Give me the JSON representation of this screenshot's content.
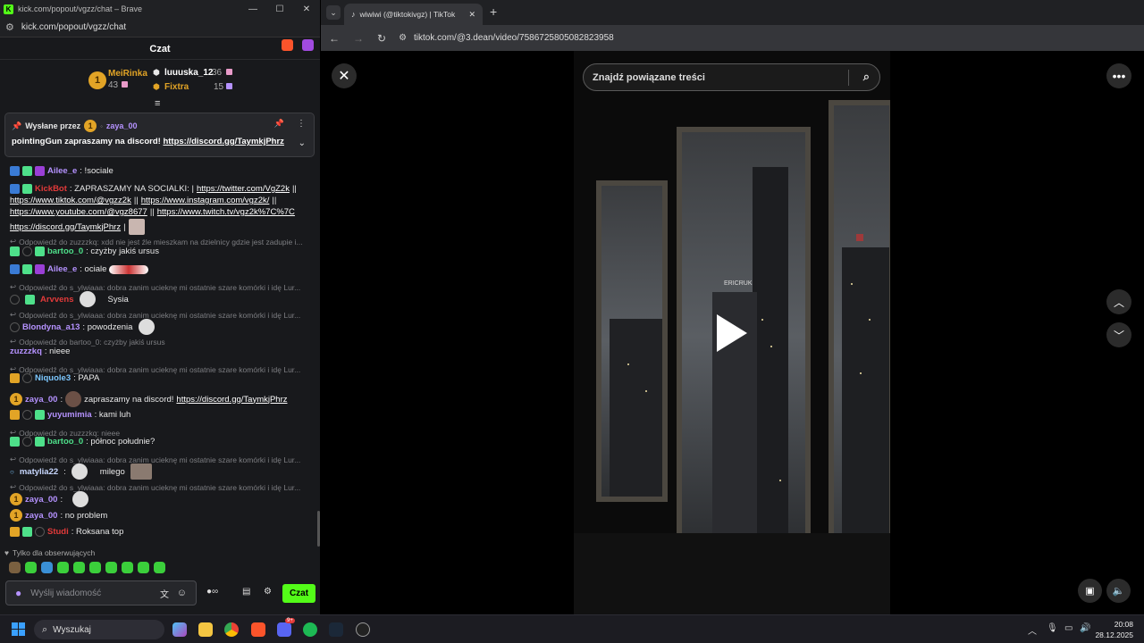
{
  "left_window": {
    "title": "kick.com/popout/vgzz/chat – Brave",
    "url": "kick.com/popout/vgzz/chat"
  },
  "chat": {
    "header": "Czat",
    "leaderboard": [
      {
        "rank": "1",
        "name": "MeiRinka",
        "count": "43"
      },
      {
        "name": "luuuska_12",
        "count": "36"
      },
      {
        "name": "Fixtra",
        "count": "15"
      }
    ],
    "pinned": {
      "sent_by_label": "Wysłane przez",
      "sender_badge": "1",
      "sender": "zaya_00",
      "text": "pointingGun zapraszamy na discord! ",
      "link": "https://discord.gg/TaymkjPhrz"
    },
    "messages": {
      "m1_user": "Ailee_e",
      "m1_text": ": !sociale",
      "m2_user": "KickBot",
      "m2_text": ": ZAPRASZAMY NA SOCIALKI: |",
      "m2_l1": "https://twitter.com/VgZ2k",
      "m2_sep1": "||",
      "m2_l2": "https://www.tiktok.com/@vgzz2k",
      "m2_sep2": "||",
      "m2_l3": "https://www.instagram.com/vgz2k/",
      "m2_sep3": "||",
      "m2_l4": "https://www.youtube.com/@vgz8677",
      "m2_sep4": "||",
      "m2_l5": "https://www.twitch.tv/vgz2k%7C%7C",
      "m2_l6": "https://discord.gg/TaymkjPhrz",
      "m2_sep6": "|",
      "r1": "Odpowiedź do zuzzzkq: xdd nie jest źle mieszkam na dzielnicy gdzie jest zadupie i...",
      "m3_user": "bartoo_0",
      "m3_text": ": czyżby jakiś ursus",
      "m4_user": "Ailee_e",
      "m4_text": ": ociale",
      "r2": "Odpowiedź do s_ylwiaaa: dobra zanim ucieknę mi ostatnie szare komórki i idę Lur...",
      "m5_user": "Arvvens",
      "m5_text": "Sysia",
      "r3": "Odpowiedź do s_ylwiaaa: dobra zanim ucieknę mi ostatnie szare komórki i idę Lur...",
      "m6_user": "Blondyna_a13",
      "m6_text": ": powodzenia",
      "r4": "Odpowiedź do bartoo_0: czyżby jakiś ursus",
      "m7_user": "zuzzzkq",
      "m7_text": ": nieee",
      "r5": "Odpowiedź do s_ylwiaaa: dobra zanim ucieknę mi ostatnie szare komórki i idę Lur...",
      "m8_user": "Niquole3",
      "m8_text": ": PAPA",
      "m9_badge": "1",
      "m9_user": "zaya_00",
      "m9_text": "zapraszamy na discord! ",
      "m9_link": "https://discord.gg/TaymkjPhrz",
      "m10_user": "yuyumimia",
      "m10_text": ": kami luh",
      "r6": "Odpowiedź do zuzzzkq: nieee",
      "m11_user": "bartoo_0",
      "m11_text": ": północ południe?",
      "r7": "Odpowiedź do s_ylwiaaa: dobra zanim ucieknę mi ostatnie szare komórki i idę Lur...",
      "m12_user": "matylia22",
      "m12_text": "milego",
      "r8": "Odpowiedź do s_ylwiaaa: dobra zanim ucieknę mi ostatnie szare komórki i idę Lur...",
      "m13_badge": "1",
      "m13_user": "zaya_00",
      "m14_badge": "1",
      "m14_user": "zaya_00",
      "m14_text": ": no problem",
      "m15_user": "Studi",
      "m15_text": ": Roksana top"
    },
    "followers_only": "Tylko dla obserwujących",
    "input_placeholder": "Wyślij wiadomość",
    "send_label": "Czat"
  },
  "right_window": {
    "tab_title": "wiwiwi (@tiktokivgz) | TikTok",
    "url": "tiktok.com/@3.dean/video/7586725805082823958",
    "search_placeholder": "Znajdź powiązane treści",
    "building_sign": "ERICRUK"
  },
  "taskbar": {
    "search_label": "Wyszukaj",
    "time": "20:08",
    "date": "28.12.2025",
    "discord_badge": "9+"
  },
  "colors": {
    "kick_green": "#53fc18",
    "chat_bg": "#18191c",
    "name_green": "#4ee08a",
    "name_purple": "#b592ff",
    "name_red": "#e23a3a",
    "name_blue": "#7dc8ff"
  }
}
